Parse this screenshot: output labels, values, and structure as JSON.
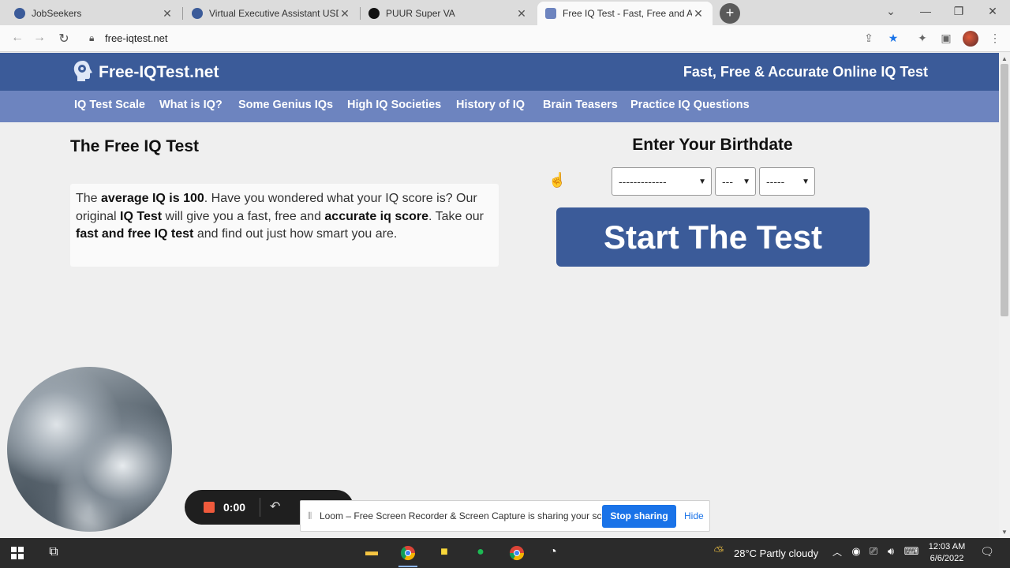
{
  "browser": {
    "tabs": [
      {
        "title": "JobSeekers",
        "favicon_color": "#3b5b99",
        "active": false
      },
      {
        "title": "Virtual Executive Assistant USD $",
        "favicon_color": "#3b5b99",
        "active": false
      },
      {
        "title": "PUUR Super VA",
        "favicon_color": "#111111",
        "active": false
      },
      {
        "title": "Free IQ Test - Fast, Free and Accu",
        "favicon_color": "#6d84bf",
        "active": true
      }
    ],
    "new_tab_symbol": "+",
    "url": "free-iqtest.net"
  },
  "site": {
    "logo_text": "Free-IQTest.net",
    "tagline": "Fast, Free & Accurate Online IQ Test",
    "nav": [
      "IQ Test Scale",
      "What is IQ?",
      "Some Genius IQs",
      "High IQ Societies",
      "History of IQ",
      "Brain Teasers",
      "Practice IQ Questions"
    ],
    "brand_color": "#3b5b99",
    "nav_color": "#6d84bf"
  },
  "main": {
    "title": "The Free IQ Test",
    "intro": {
      "p1": "The ",
      "b1": "average IQ is 100",
      "p2": ". Have you wondered what your IQ score is? Our original ",
      "b2": "IQ Test",
      "p3": " will give you a fast, free and ",
      "b3": "accurate iq score",
      "p4": ". Take our ",
      "b4": "fast and free IQ test",
      "p5": " and find out just how smart you are."
    },
    "birthdate": {
      "title": "Enter Your Birthdate",
      "month_value": "-------------",
      "day_value": "---",
      "year_value": "-----"
    },
    "start_button": "Start The Test"
  },
  "loom": {
    "timer": "0:00",
    "share_message": "Loom – Free Screen Recorder & Screen Capture is sharing your screen.",
    "stop_label": "Stop sharing",
    "hide_label": "Hide"
  },
  "taskbar": {
    "weather": "28°C  Partly cloudy",
    "time": "12:03 AM",
    "date": "6/6/2022"
  }
}
